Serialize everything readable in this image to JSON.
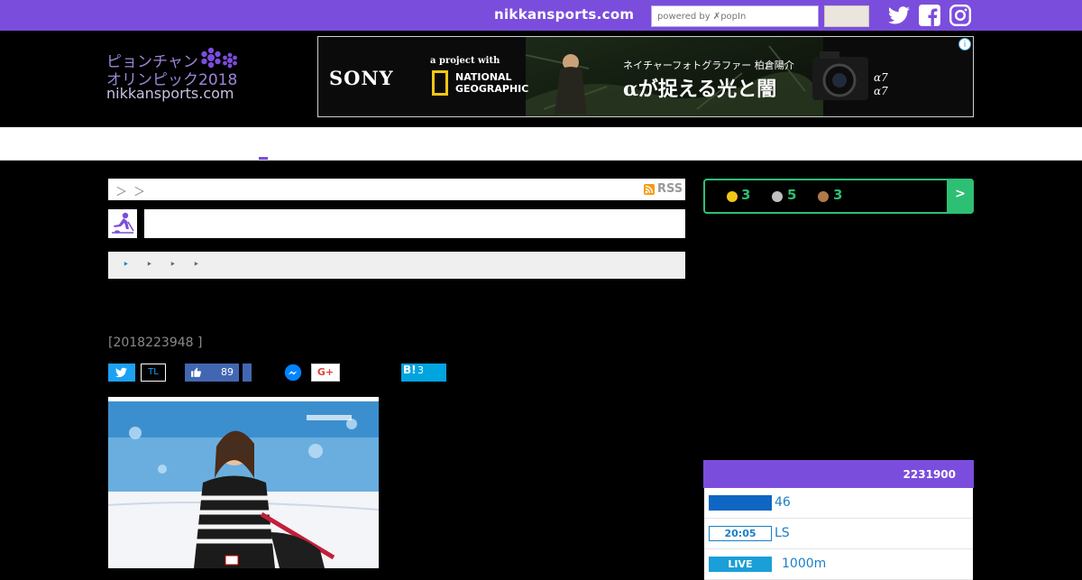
{
  "topbar": {
    "brand": "nikkansports.com",
    "search_placeholder": "powered by ✗popIn",
    "search_button_label": "",
    "social": [
      {
        "name": "twitter",
        "icon": "twitter-icon"
      },
      {
        "name": "facebook",
        "icon": "facebook-icon"
      },
      {
        "name": "instagram",
        "icon": "instagram-icon"
      }
    ]
  },
  "header": {
    "logo_line1": "ピョンチャン",
    "logo_line2": "オリンピック2018",
    "logo_line3": "nikkansports.com",
    "ad": {
      "brand": "SONY",
      "tag_small": "a project with",
      "tag_ng_line1": "NATIONAL",
      "tag_ng_line2": "GEOGRAPHIC",
      "jp_small": "ネイチャーフォトグラファー 柏倉陽介",
      "jp_big": "αが捉える光と闇",
      "model_line1": "α7",
      "model_line2": "α7",
      "info_icon": "info-icon"
    }
  },
  "breadcrumb": {
    "separators": [
      "＞",
      "＞"
    ],
    "rss_label": "RSS"
  },
  "tabs": {
    "arrows": [
      "‣",
      "‣",
      "‣",
      "‣"
    ]
  },
  "article": {
    "date": "[2018223948 ]",
    "share": {
      "twitter_label": "",
      "tl_label": "TL",
      "like_count": "89",
      "gplus_label": "G+",
      "hatena_label": "B!",
      "hatena_count": "3"
    }
  },
  "medals": {
    "gold": "3",
    "silver": "5",
    "bronze": "3",
    "arrow_label": ">",
    "colors": {
      "gold": "#f2c714",
      "silver": "#c0c0c0",
      "bronze": "#b07a4a",
      "accent": "#2dbf73"
    }
  },
  "schedule": {
    "header_label": "2231900",
    "rows": [
      {
        "tag": "",
        "text": "46"
      },
      {
        "tag": "20:05",
        "text": "LS"
      },
      {
        "tag": "LIVE",
        "text": "1000m"
      }
    ]
  },
  "colors": {
    "brand_purple": "#7b4ddc",
    "medal_green": "#2dbf73",
    "link_blue": "#1a7fc7"
  }
}
